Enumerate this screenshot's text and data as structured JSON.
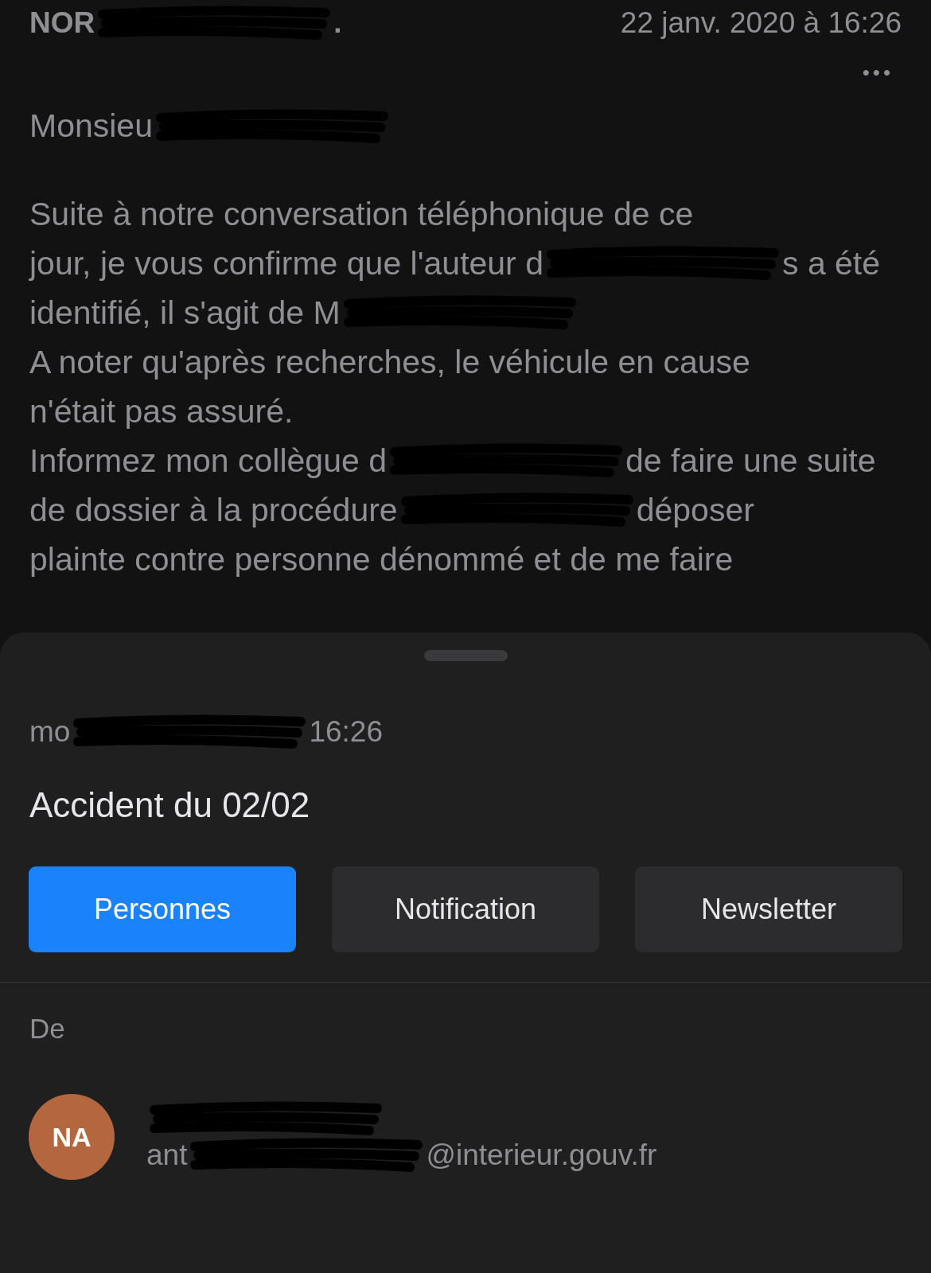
{
  "header": {
    "sender": [
      {
        "kind": "text",
        "text": "NOR"
      },
      {
        "kind": "redaction"
      },
      {
        "kind": "text",
        "text": "."
      }
    ],
    "date": "22 janv. 2020 à 16:26",
    "more": "•••"
  },
  "greeting": [
    {
      "kind": "text",
      "text": "Monsieu"
    },
    {
      "kind": "redaction"
    }
  ],
  "body_lines": [
    [
      {
        "kind": "text",
        "text": "Suite à notre conversation téléphonique de ce"
      }
    ],
    [
      {
        "kind": "text",
        "text": "jour, je vous confirme que l'auteur d"
      },
      {
        "kind": "redaction"
      },
      {
        "kind": "text",
        "text": "s a été"
      }
    ],
    [
      {
        "kind": "text",
        "text": "identifié, il s'agit de M"
      },
      {
        "kind": "redaction"
      }
    ],
    [
      {
        "kind": "text",
        "text": "A noter qu'après recherches, le véhicule en cause"
      }
    ],
    [
      {
        "kind": "text",
        "text": "n'était pas assuré."
      }
    ],
    [
      {
        "kind": "text",
        "text": "Informez mon collègue d"
      },
      {
        "kind": "redaction"
      },
      {
        "kind": "text",
        "text": "de faire une suite"
      }
    ],
    [
      {
        "kind": "text",
        "text": "de dossier à la procédure"
      },
      {
        "kind": "redaction"
      },
      {
        "kind": "text",
        "text": "déposer"
      }
    ],
    [
      {
        "kind": "text",
        "text": "plainte contre personne dénommé et de me faire"
      }
    ]
  ],
  "sheet": {
    "date_line": [
      {
        "kind": "text",
        "text": "mo"
      },
      {
        "kind": "redaction"
      },
      {
        "kind": "text",
        "text": "16:26"
      }
    ],
    "subject": "Accident du 02/02",
    "buttons": [
      {
        "label": "Personnes",
        "selected": true
      },
      {
        "label": "Notification",
        "selected": false
      },
      {
        "label": "Newsletter",
        "selected": false
      }
    ],
    "from_label": "De",
    "sender": {
      "initials": "NA",
      "name": [
        {
          "kind": "redaction"
        }
      ],
      "email": [
        {
          "kind": "text",
          "text": "ant"
        },
        {
          "kind": "redaction"
        },
        {
          "kind": "text",
          "text": "@interieur.gouv.fr"
        }
      ]
    }
  }
}
